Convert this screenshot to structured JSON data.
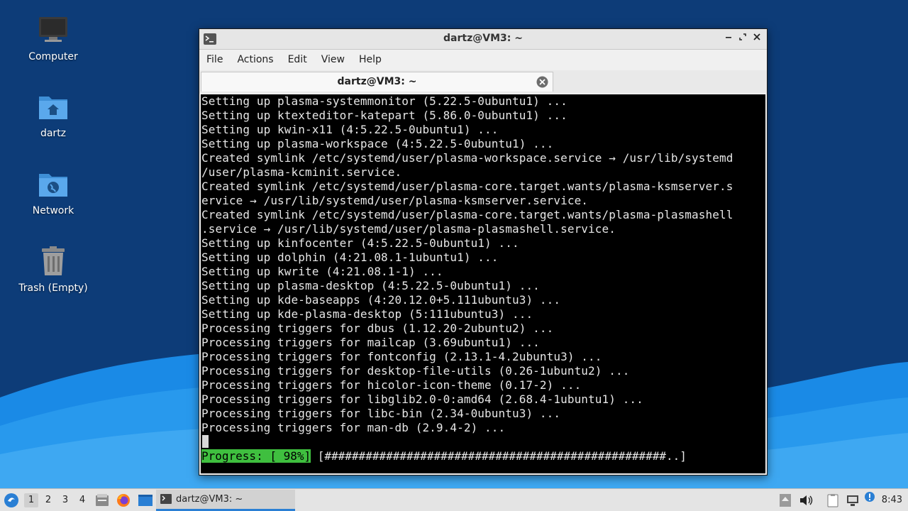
{
  "colors": {
    "desktop_top": "#0d3c78",
    "desktop_wave": "#1a8ae6",
    "terminal_bg": "#000000",
    "terminal_fg": "#e6e6e6",
    "progress_label_bg": "#3fbf3f",
    "taskbar_bg": "#e4e4e4",
    "active_task_accent": "#2a7fd4"
  },
  "desktop": {
    "icons": [
      {
        "label": "Computer",
        "icon": "computer-icon"
      },
      {
        "label": "dartz",
        "icon": "home-folder-icon"
      },
      {
        "label": "Network",
        "icon": "network-folder-icon"
      },
      {
        "label": "Trash (Empty)",
        "icon": "trash-icon"
      }
    ]
  },
  "window": {
    "title": "dartz@VM3: ~",
    "menu": [
      "File",
      "Actions",
      "Edit",
      "View",
      "Help"
    ],
    "tab_label": "dartz@VM3: ~",
    "terminal_lines": [
      "Setting up plasma-systemmonitor (5.22.5-0ubuntu1) ...",
      "Setting up ktexteditor-katepart (5.86.0-0ubuntu1) ...",
      "Setting up kwin-x11 (4:5.22.5-0ubuntu1) ...",
      "Setting up plasma-workspace (4:5.22.5-0ubuntu1) ...",
      "Created symlink /etc/systemd/user/plasma-workspace.service → /usr/lib/systemd",
      "/user/plasma-kcminit.service.",
      "Created symlink /etc/systemd/user/plasma-core.target.wants/plasma-ksmserver.s",
      "ervice → /usr/lib/systemd/user/plasma-ksmserver.service.",
      "Created symlink /etc/systemd/user/plasma-core.target.wants/plasma-plasmashell",
      ".service → /usr/lib/systemd/user/plasma-plasmashell.service.",
      "Setting up kinfocenter (4:5.22.5-0ubuntu1) ...",
      "Setting up dolphin (4:21.08.1-1ubuntu1) ...",
      "Setting up kwrite (4:21.08.1-1) ...",
      "Setting up plasma-desktop (4:5.22.5-0ubuntu1) ...",
      "Setting up kde-baseapps (4:20.12.0+5.111ubuntu3) ...",
      "Setting up kde-plasma-desktop (5:111ubuntu3) ...",
      "Processing triggers for dbus (1.12.20-2ubuntu2) ...",
      "Processing triggers for mailcap (3.69ubuntu1) ...",
      "Processing triggers for fontconfig (2.13.1-4.2ubuntu3) ...",
      "Processing triggers for desktop-file-utils (0.26-1ubuntu2) ...",
      "Processing triggers for hicolor-icon-theme (0.17-2) ...",
      "Processing triggers for libglib2.0-0:amd64 (2.68.4-1ubuntu1) ...",
      "Processing triggers for libc-bin (2.34-0ubuntu3) ...",
      "Processing triggers for man-db (2.9.4-2) ..."
    ],
    "progress": {
      "label": "Progress: [ 98%]",
      "bar": " [##################################################..]",
      "percent": 98
    }
  },
  "taskbar": {
    "workspaces": [
      "1",
      "2",
      "3",
      "4"
    ],
    "active_workspace": "1",
    "task_label": "dartz@VM3: ~",
    "clock": "8:43"
  }
}
